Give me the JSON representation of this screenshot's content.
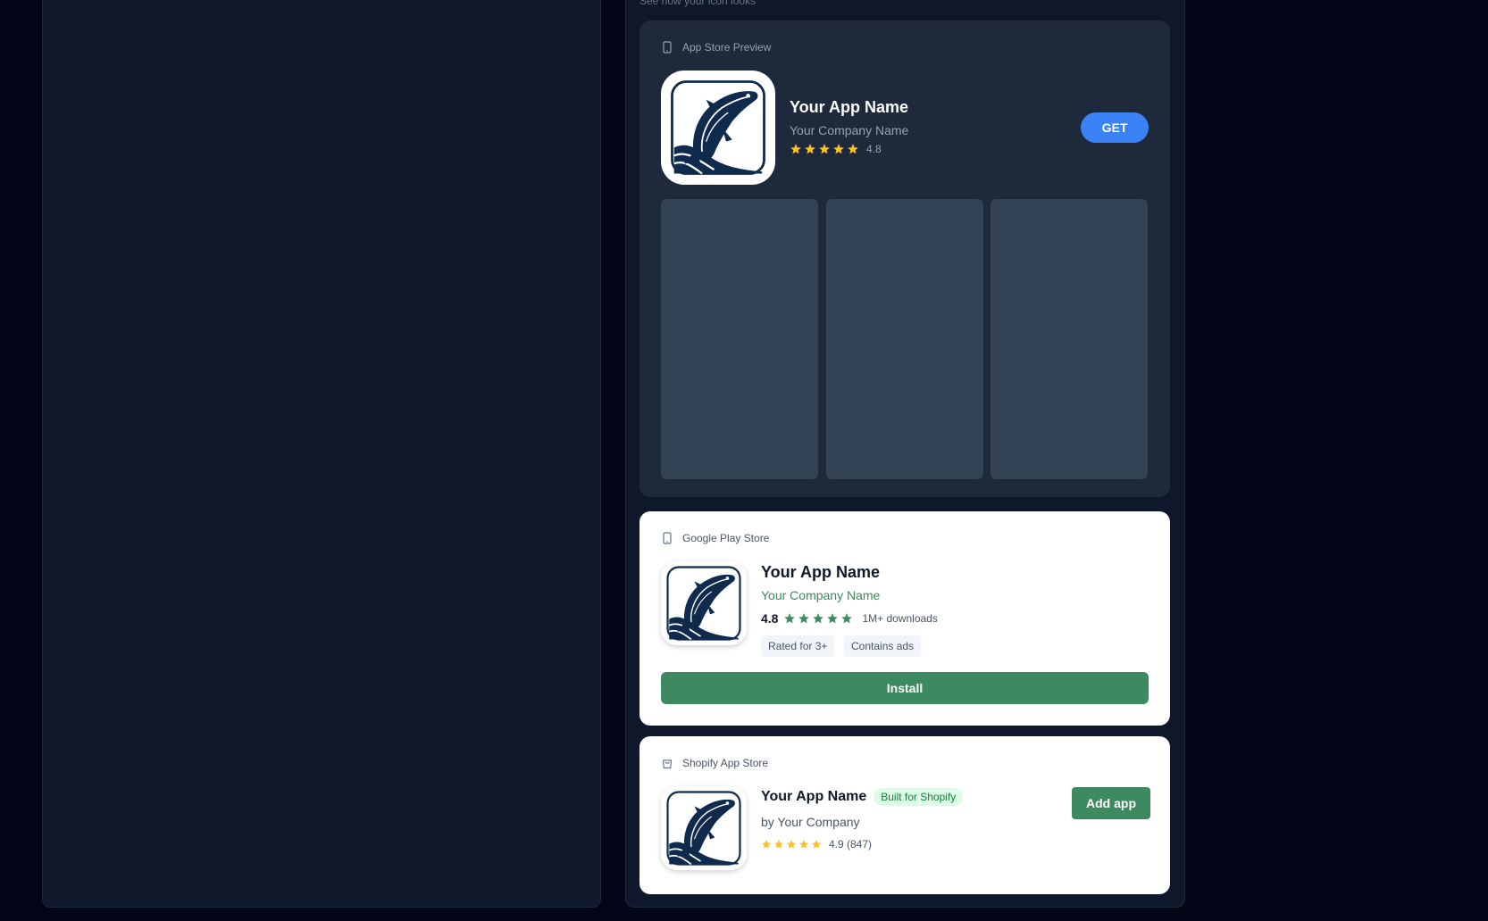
{
  "hint": "See how your icon looks",
  "app_store": {
    "label": "App Store Preview",
    "app_name": "Your App Name",
    "company": "Your Company Name",
    "rating": "4.8",
    "rating_stars": 5,
    "button": "GET",
    "screenshot_count": 3
  },
  "google_play": {
    "label": "Google Play Store",
    "app_name": "Your App Name",
    "company": "Your Company Name",
    "rating": "4.8",
    "downloads": "1M+ downloads",
    "tags": [
      "Rated for 3+",
      "Contains ads"
    ],
    "button": "Install"
  },
  "shopify": {
    "label": "Shopify App Store",
    "app_name": "Your App Name",
    "badge": "Built for Shopify",
    "by": "by Your Company",
    "rating": "4.9 (847)",
    "button": "Add app"
  },
  "colors": {
    "background": "#020617",
    "panel": "#0f172a",
    "ios_card": "#1e293b",
    "ios_button": "#3b82f6",
    "google_green": "#3d8a60",
    "star_gold": "#fbbf24",
    "icon_navy": "#0f2a4d"
  },
  "icons": {
    "app_store": "phone-icon",
    "google_play": "phone-icon",
    "shopify": "shopping-bag-icon",
    "app_icon": "fish-icon"
  }
}
